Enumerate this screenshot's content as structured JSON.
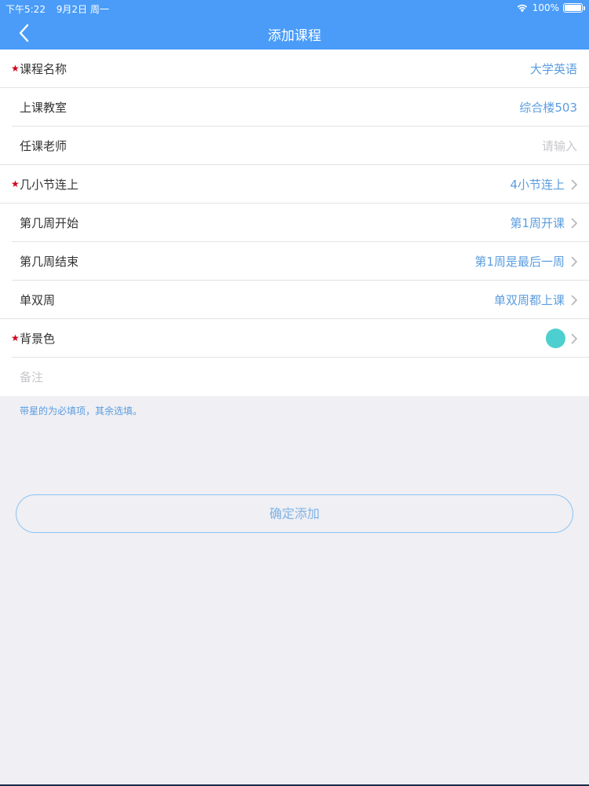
{
  "status": {
    "time": "下午5:22",
    "date": "9月2日 周一",
    "battery": "100%"
  },
  "nav": {
    "title": "添加课程"
  },
  "form": {
    "course_name": {
      "label": "课程名称",
      "value": "大学英语",
      "required": true
    },
    "classroom": {
      "label": "上课教室",
      "value": "综合楼503"
    },
    "teacher": {
      "label": "任课老师",
      "placeholder": "请输入"
    },
    "sections": {
      "label": "几小节连上",
      "value": "4小节连上",
      "required": true
    },
    "start_week": {
      "label": "第几周开始",
      "value": "第1周开课"
    },
    "end_week": {
      "label": "第几周结束",
      "value": "第1周是最后一周"
    },
    "odd_even": {
      "label": "单双周",
      "value": "单双周都上课"
    },
    "bg_color": {
      "label": "背景色",
      "color": "#4ecfcf",
      "required": true
    },
    "note": {
      "placeholder": "备注"
    }
  },
  "hint": "带星的为必填项，其余选填。",
  "submit_label": "确定添加",
  "colors": {
    "accent": "#4a9cf8",
    "value_text": "#5b9ddf",
    "required_star": "#d0021b"
  }
}
